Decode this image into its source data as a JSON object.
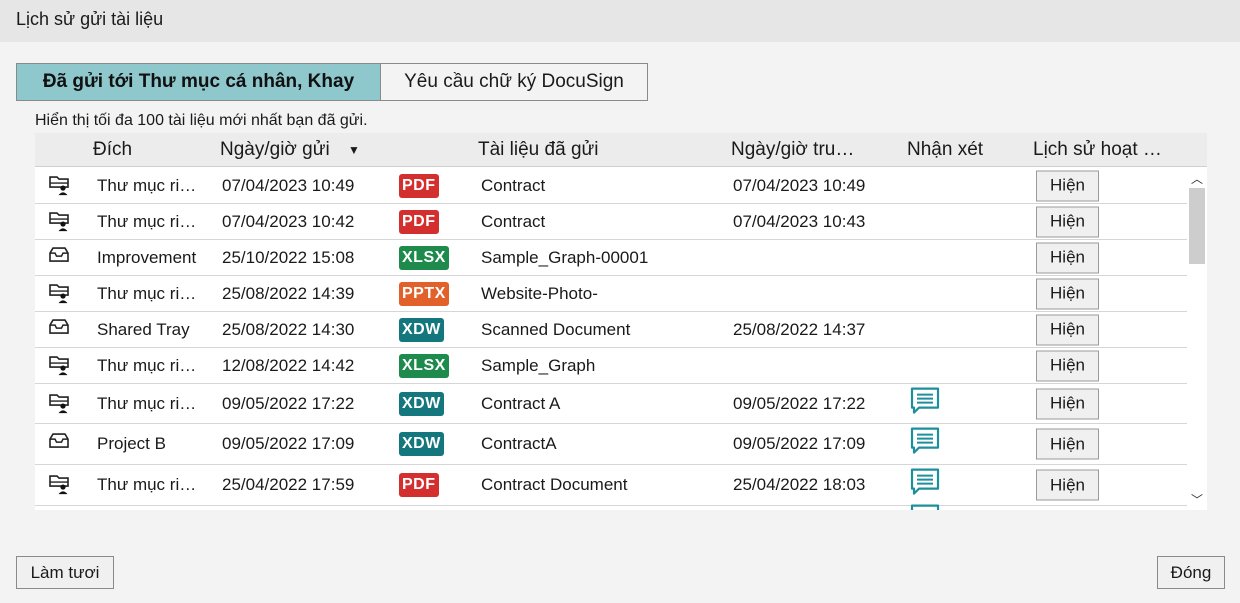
{
  "window": {
    "title": "Lịch sử gửi tài liệu"
  },
  "tabs": [
    {
      "label": "Đã gửi tới Thư mục cá nhân, Khay",
      "active": true
    },
    {
      "label": "Yêu cầu chữ ký DocuSign",
      "active": false
    }
  ],
  "note": "Hiển thị tối đa 100 tài liệu mới nhất bạn đã gửi.",
  "table": {
    "headers": {
      "destination": "Đích",
      "sent_datetime": "Ngày/giờ gửi",
      "document": "Tài liệu đã gửi",
      "received_datetime": "Ngày/giờ tru…",
      "comment": "Nhận xét",
      "history": "Lịch sử hoạt …"
    },
    "sort": {
      "column": "sent_datetime",
      "direction": "descending",
      "icon": "sort-down-icon"
    },
    "rows": [
      {
        "dest_icon": "personal-folder-icon",
        "destination": "Thư mục ri…",
        "sent": "07/04/2023 10:49",
        "type": "PDF",
        "document": "Contract",
        "received": "07/04/2023 10:49",
        "comment": false,
        "button": "Hiện"
      },
      {
        "dest_icon": "personal-folder-icon",
        "destination": "Thư mục ri…",
        "sent": "07/04/2023 10:42",
        "type": "PDF",
        "document": "Contract",
        "received": "07/04/2023 10:43",
        "comment": false,
        "button": "Hiện"
      },
      {
        "dest_icon": "tray-icon",
        "destination": "Improvement",
        "sent": "25/10/2022 15:08",
        "type": "XLSX",
        "document": "Sample_Graph-00001",
        "received": "",
        "comment": false,
        "button": "Hiện"
      },
      {
        "dest_icon": "personal-folder-icon",
        "destination": "Thư mục ri…",
        "sent": "25/08/2022 14:39",
        "type": "PPTX",
        "document": "Website-Photo-",
        "received": "",
        "comment": false,
        "button": "Hiện"
      },
      {
        "dest_icon": "tray-icon",
        "destination": "Shared Tray",
        "sent": "25/08/2022 14:30",
        "type": "XDW",
        "document": "Scanned Document",
        "received": "25/08/2022 14:37",
        "comment": false,
        "button": "Hiện"
      },
      {
        "dest_icon": "personal-folder-icon",
        "destination": "Thư mục ri…",
        "sent": "12/08/2022 14:42",
        "type": "XLSX",
        "document": "Sample_Graph",
        "received": "",
        "comment": false,
        "button": "Hiện"
      },
      {
        "dest_icon": "personal-folder-icon",
        "destination": "Thư mục ri…",
        "sent": "09/05/2022 17:22",
        "type": "XDW",
        "document": "Contract A",
        "received": "09/05/2022 17:22",
        "comment": true,
        "button": "Hiện"
      },
      {
        "dest_icon": "tray-icon",
        "destination": "Project B",
        "sent": "09/05/2022 17:09",
        "type": "XDW",
        "document": "ContractA",
        "received": "09/05/2022 17:09",
        "comment": true,
        "button": "Hiện"
      },
      {
        "dest_icon": "personal-folder-icon",
        "destination": "Thư mục ri…",
        "sent": "25/04/2022 17:59",
        "type": "PDF",
        "document": "Contract Document",
        "received": "25/04/2022 18:03",
        "comment": true,
        "button": "Hiện"
      },
      {
        "dest_icon": "",
        "destination": "",
        "sent": "",
        "type": "",
        "document": "",
        "received": "",
        "comment": true,
        "button": ""
      }
    ]
  },
  "type_colors": {
    "PDF": "#d32f2f",
    "XLSX": "#1e8a4c",
    "PPTX": "#e2602a",
    "XDW": "#13777d"
  },
  "comment_color": "#1d8f9c",
  "footer": {
    "refresh_label": "Làm tươi",
    "close_label": "Đóng"
  }
}
